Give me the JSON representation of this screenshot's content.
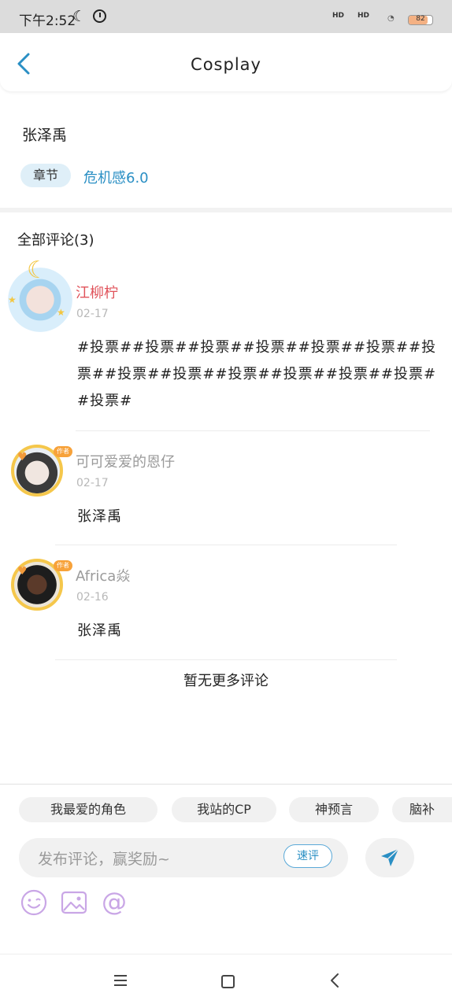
{
  "status_bar": {
    "time": "下午2:52",
    "hd1": "HD",
    "hd2": "HD",
    "battery": "82"
  },
  "header": {
    "title": "Cosplay",
    "back_icon": "chevron-left-icon"
  },
  "post": {
    "author": "张泽禹",
    "chapter_tag": "章节",
    "chapter_name": "危机感6.0"
  },
  "comments_section": {
    "heading": "全部评论(3)",
    "comments": [
      {
        "name": "江柳柠",
        "name_color": "#e0525a",
        "date": "02-17",
        "body": "#投票##投票##投票##投票##投票##投票##投票##投票##投票##投票##投票##投票##投票##投票#"
      },
      {
        "name": "可可爱爱的恩仔",
        "name_color": "#9a9a9a",
        "date": "02-17",
        "body": "张泽禹"
      },
      {
        "name": "Africa焱",
        "name_color": "#9a9a9a",
        "date": "02-16",
        "body": "张泽禹"
      }
    ],
    "no_more": "暂无更多评论"
  },
  "input_panel": {
    "chips": [
      "我最爱的角色",
      "我站的CP",
      "神预言",
      "脑补"
    ],
    "placeholder": "发布评论，赢奖励~",
    "quick_review": "速评",
    "send_icon": "paper-plane-icon",
    "tools": [
      "emoji-icon",
      "image-icon",
      "mention-icon"
    ]
  },
  "colors": {
    "accent": "#2a8fc4",
    "tool_purple": "#c9a6e6"
  }
}
